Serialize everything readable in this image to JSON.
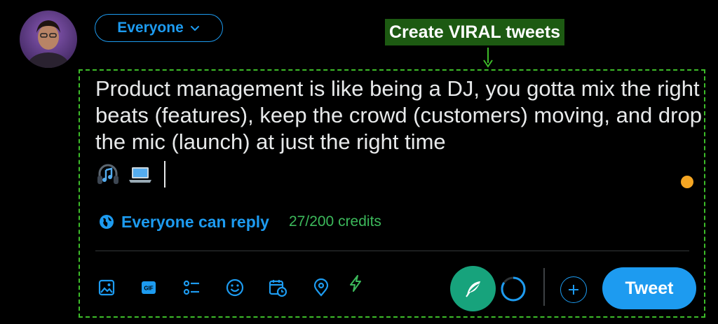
{
  "audience": {
    "label": "Everyone"
  },
  "annotation": {
    "label": "Create VIRAL tweets"
  },
  "compose": {
    "text": "Product management is like being a DJ, you gotta mix the right beats (features), keep the crowd (customers) moving, and drop the mic (launch) at just the right time"
  },
  "reply_setting": {
    "label": "Everyone can reply"
  },
  "credits": {
    "label": "27/200 credits"
  },
  "toolbar": {
    "tweet_label": "Tweet"
  },
  "icons": {
    "media": "image-icon",
    "gif": "gif-icon",
    "poll": "poll-icon",
    "emoji": "smiley-icon",
    "schedule": "calendar-clock-icon",
    "location": "location-pin-icon",
    "ai": "lightning-icon",
    "quill": "quill-feather-icon",
    "add": "plus-icon",
    "globe": "globe-icon"
  },
  "colors": {
    "accent": "#1d9bf0",
    "credits": "#3cb95b",
    "annotation_bg": "#1d5a12",
    "dashed_border": "#3dbb29",
    "quill_bg": "#17a37c",
    "status_dot": "#f5a623"
  }
}
